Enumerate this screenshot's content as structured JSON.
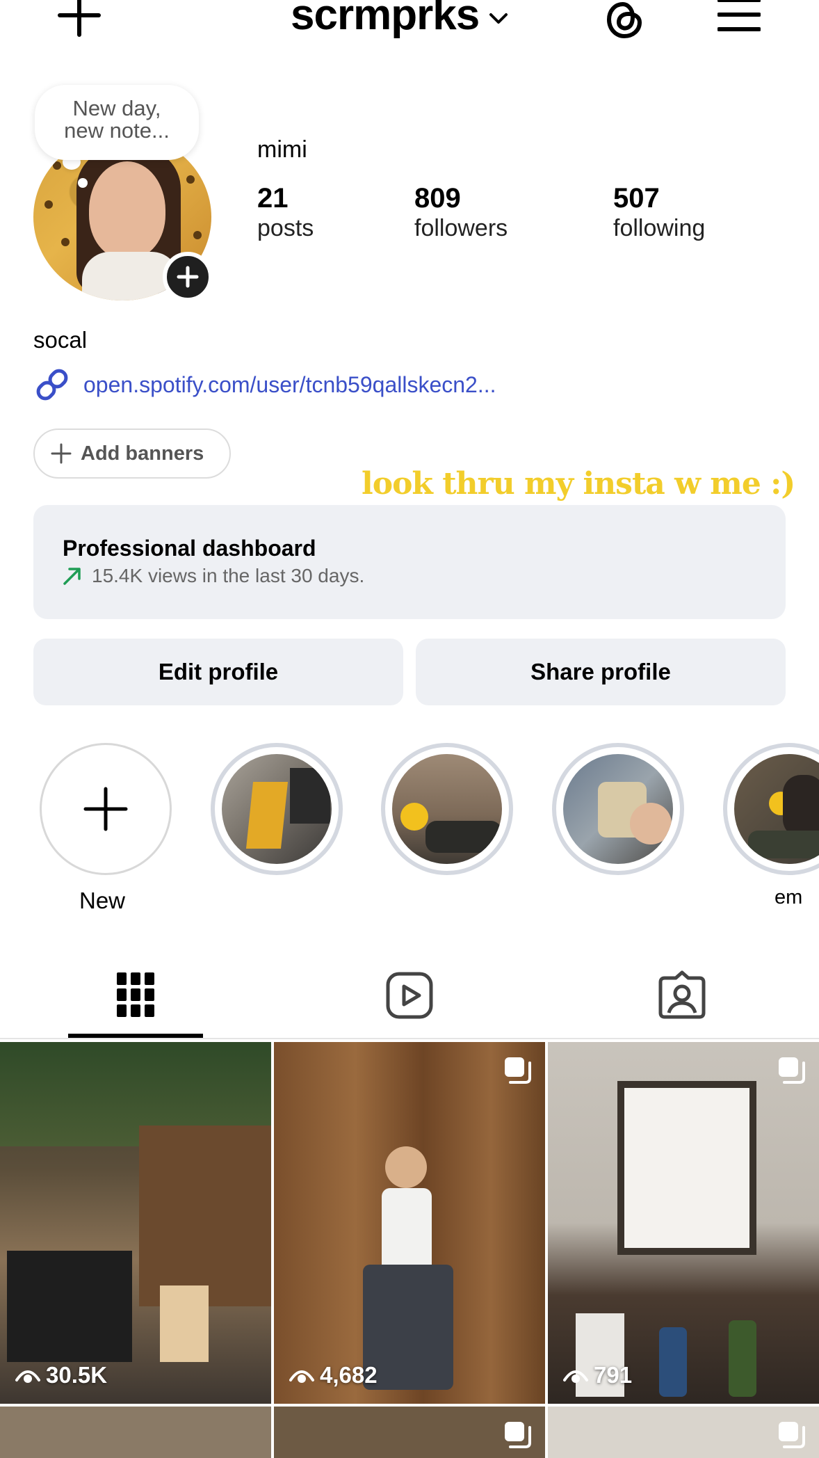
{
  "header": {
    "username": "scrmprks",
    "create_icon": "plus-icon",
    "threads_icon": "threads-icon",
    "menu_icon": "hamburger-menu-icon"
  },
  "profile": {
    "note": "New day,\nnew note...",
    "display_name": "mimi",
    "stats": [
      {
        "value": "21",
        "label": "posts"
      },
      {
        "value": "809",
        "label": "followers"
      },
      {
        "value": "507",
        "label": "following"
      }
    ],
    "bio": "socal",
    "link": "open.spotify.com/user/tcnb59qallskecn2..."
  },
  "add_banners_label": "Add banners",
  "overlay_caption": "look thru my insta w me :)",
  "dashboard": {
    "title": "Professional dashboard",
    "subtitle": "15.4K views in the last 30 days."
  },
  "buttons": {
    "edit": "Edit profile",
    "share": "Share profile"
  },
  "highlights": [
    {
      "label": "New"
    },
    {
      "label": ""
    },
    {
      "label": ""
    },
    {
      "label": ""
    },
    {
      "label": "em"
    }
  ],
  "tabs": [
    "grid-icon",
    "reels-icon",
    "tagged-icon"
  ],
  "posts": [
    {
      "views": "30.5K",
      "multi": false
    },
    {
      "views": "4,682",
      "multi": true
    },
    {
      "views": "791",
      "multi": true
    }
  ],
  "colors": {
    "link": "#3a4fc8",
    "caption": "#f2cd2b",
    "panel": "#eef0f4",
    "trend_up": "#1f9d55"
  }
}
